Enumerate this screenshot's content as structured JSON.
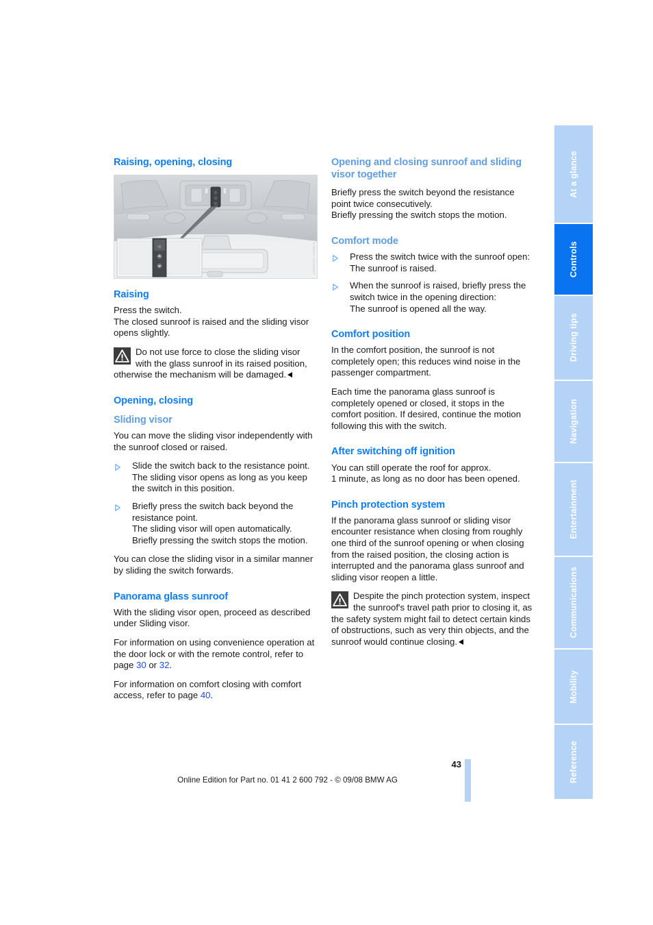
{
  "document": {
    "page_number": "43",
    "footer_text": "Online Edition for Part no. 01 41 2 600 792 - © 09/08 BMW AG"
  },
  "sidebar": {
    "tabs": [
      {
        "label": "At a glance",
        "active": false
      },
      {
        "label": "Controls",
        "active": true
      },
      {
        "label": "Driving tips",
        "active": false
      },
      {
        "label": "Navigation",
        "active": false
      },
      {
        "label": "Entertainment",
        "active": false
      },
      {
        "label": "Communications",
        "active": false
      },
      {
        "label": "Mobility",
        "active": false
      },
      {
        "label": "Reference",
        "active": false
      }
    ]
  },
  "colors": {
    "heading_blue": "#0d7ef5",
    "subheading_blue": "#5e9ee8",
    "tab_blue": "#b4d3f7",
    "tab_active_blue": "#0a74f0",
    "link_blue": "#1a4ff0"
  },
  "left_column": {
    "heading": "Raising, opening, closing",
    "figure": {
      "caption_code": "AVBBFAB1 KG0BVR",
      "alt": "Overhead console sunroof switch with magnified inset and rearview mirror"
    },
    "raising": {
      "heading": "Raising",
      "para1": "Press the switch.\nThe closed sunroof is raised and the sliding visor opens slightly.",
      "warning": "Do not use force to close the sliding visor with the glass sunroof in its raised position, otherwise the mechanism will be damaged."
    },
    "opening_closing": {
      "heading": "Opening, closing",
      "sliding_visor": {
        "heading": "Sliding visor",
        "intro": "You can move the sliding visor independently with the sunroof closed or raised.",
        "steps": [
          "Slide the switch back to the resistance point.\nThe sliding visor opens as long as you keep the switch in this position.",
          "Briefly press the switch back beyond the resistance point.\nThe sliding visor will open automatically.\nBriefly pressing the switch stops the motion."
        ],
        "outro": "You can close the sliding visor in a similar manner by sliding the switch forwards."
      }
    },
    "panorama": {
      "heading": "Panorama glass sunroof",
      "para1": "With the sliding visor open, proceed as described under Sliding visor.",
      "para2_before": "For information on using convenience operation at the door lock or with the remote control, refer to page ",
      "para2_link1": "30",
      "para2_mid": " or ",
      "para2_link2": "32",
      "para2_after": ".",
      "para3_before": "For information on comfort closing with comfort access, refer to page ",
      "para3_link": "40",
      "para3_after": "."
    }
  },
  "right_column": {
    "together": {
      "heading": "Opening and closing sunroof and sliding visor together",
      "para1": "Briefly press the switch beyond the resistance point twice consecutively.\nBriefly pressing the switch stops the motion."
    },
    "comfort_mode": {
      "heading": "Comfort mode",
      "steps": [
        "Press the switch twice with the sunroof open:\nThe sunroof is raised.",
        "When the sunroof is raised, briefly press the switch twice in the opening direction:\nThe sunroof is opened all the way."
      ]
    },
    "comfort_position": {
      "heading": "Comfort position",
      "para1": "In the comfort position, the sunroof is not completely open; this reduces wind noise in the passenger compartment.",
      "para2": "Each time the panorama glass sunroof is completely opened or closed, it stops in the comfort position. If desired, continue the motion following this with the switch."
    },
    "after_ignition": {
      "heading": "After switching off ignition",
      "para1": "You can still operate the roof for approx.\n1 minute, as long as no door has been opened."
    },
    "pinch_protection": {
      "heading": "Pinch protection system",
      "para1": "If the panorama glass sunroof or sliding visor encounter resistance when closing from roughly one third of the sunroof opening or when closing from the raised position, the closing action is interrupted and the panorama glass sunroof and sliding visor reopen a little.",
      "warning": "Despite the pinch protection system, inspect the sunroof's travel path prior to closing it, as the safety system might fail to detect certain kinds of obstructions, such as very thin objects, and the sunroof would continue closing."
    }
  }
}
